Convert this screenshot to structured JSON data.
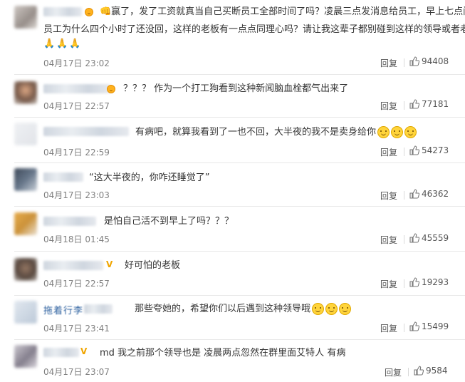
{
  "comments": [
    {
      "text1": "👊赢了，发了工资就真当自己买断员工全部时间了吗？凌晨三点发消息给员工，早上七点问",
      "text2": "员工为什么四个小时了还没回，这样的老板有一点点同理心吗？请让我这辈子都别碰到这样的领导或者老板",
      "emoji": "🙏🙏🙏",
      "date": "04月17日 23:02",
      "reply": "回复",
      "likes": "94408"
    },
    {
      "text": "？？？ 作为一个打工狗看到这种新闻脑血栓都气出来了",
      "date": "04月17日 22:57",
      "reply": "回复",
      "likes": "77181"
    },
    {
      "text": "有病吧，就算我看到了一也不回，大半夜的我不是卖身给你",
      "date": "04月17日 22:59",
      "reply": "回复",
      "likes": "54273"
    },
    {
      "text": "“这大半夜的，你咋还睡觉了”",
      "date": "04月17日 23:03",
      "reply": "回复",
      "likes": "46362"
    },
    {
      "text": "是怕自己活不到早上了吗？？？",
      "date": "04月18日 01:45",
      "reply": "回复",
      "likes": "45559"
    },
    {
      "text": "好可怕的老板",
      "date": "04月17日 22:57",
      "reply": "回复",
      "likes": "19293"
    },
    {
      "username": "拖着行李",
      "text": "那些夸她的，希望你们以后遇到这种领导哦",
      "date": "04月17日 23:41",
      "reply": "回复",
      "likes": "15499"
    },
    {
      "text": "md 我之前那个领导也是 凌晨两点忽然在群里面艾特人 有病",
      "date": "04月17日 23:07",
      "reply": "回复",
      "likes": "9584"
    }
  ],
  "vip_mark": "V",
  "icons": {
    "like": "thumbs-up-icon",
    "emoji": "smile-emoji-icon",
    "badge": "member-badge-icon"
  }
}
